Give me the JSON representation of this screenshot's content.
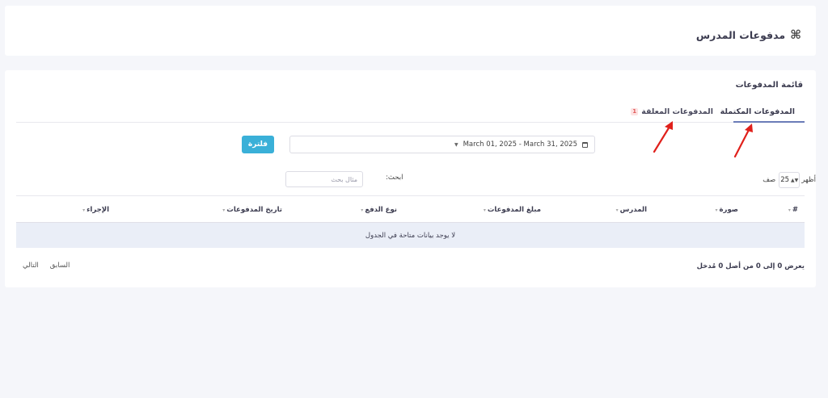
{
  "header": {
    "title": "مدفوعات المدرس",
    "icon": "command-icon"
  },
  "list": {
    "title": "قائمة المدفوعات"
  },
  "tabs": [
    {
      "label": "المدفوعات المكتملة",
      "active": true
    },
    {
      "label": "المدفوعات المعلقة",
      "badge": "1",
      "active": false
    }
  ],
  "filter": {
    "date_range": "March 01, 2025 - March 31, 2025",
    "button_label": "فلترة"
  },
  "table_controls": {
    "length_prefix": "أظهر",
    "length_value": "25",
    "length_suffix": "صف",
    "search_label": "ابحث:",
    "search_placeholder": "مثال بحث"
  },
  "table": {
    "columns": [
      "#",
      "صورة",
      "المدرس",
      "مبلغ المدفوعات",
      "نوع الدفع",
      "تاريخ المدفوعات",
      "الإجراء"
    ],
    "empty_message": "لا يوجد بيانات متاحة في الجدول"
  },
  "footer": {
    "info": "يعرض 0 إلى 0 من أصل 0 مُدخل",
    "prev_label": "السابق",
    "next_label": "التالي"
  },
  "colors": {
    "primary": "#3ab0d8",
    "accent": "#6b7cb8",
    "empty_row": "#eaeef7",
    "annotation": "#e0201b"
  }
}
